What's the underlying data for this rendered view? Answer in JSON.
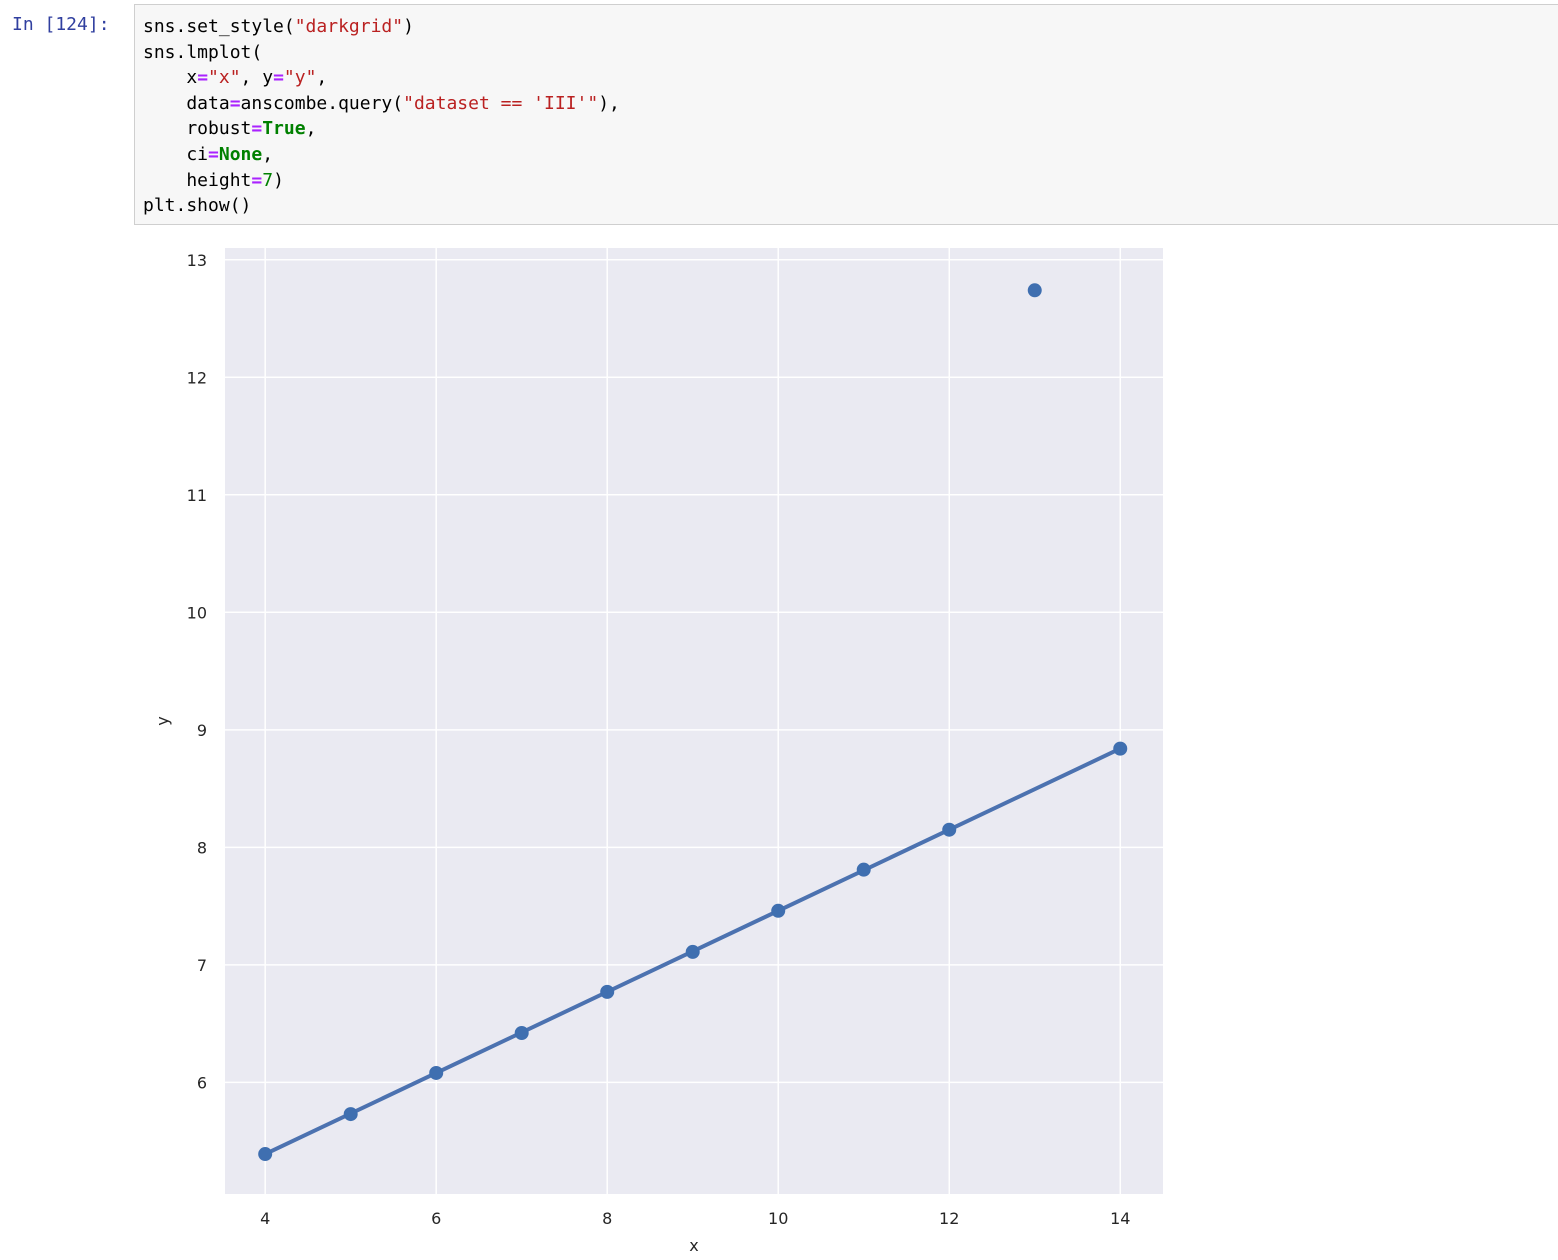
{
  "cell": {
    "prompt": "In [124]:",
    "code_lines": [
      [
        {
          "t": "sns.set_style(",
          "c": ""
        },
        {
          "t": "\"darkgrid\"",
          "c": "str"
        },
        {
          "t": ")",
          "c": ""
        }
      ],
      [
        {
          "t": "sns.lmplot(",
          "c": ""
        }
      ],
      [
        {
          "t": "    x",
          "c": ""
        },
        {
          "t": "=",
          "c": "op"
        },
        {
          "t": "\"x\"",
          "c": "str"
        },
        {
          "t": ", y",
          "c": ""
        },
        {
          "t": "=",
          "c": "op"
        },
        {
          "t": "\"y\"",
          "c": "str"
        },
        {
          "t": ",",
          "c": ""
        }
      ],
      [
        {
          "t": "    data",
          "c": ""
        },
        {
          "t": "=",
          "c": "op"
        },
        {
          "t": "anscombe.query(",
          "c": ""
        },
        {
          "t": "\"dataset == 'III'\"",
          "c": "str"
        },
        {
          "t": "),",
          "c": ""
        }
      ],
      [
        {
          "t": "    robust",
          "c": ""
        },
        {
          "t": "=",
          "c": "op"
        },
        {
          "t": "True",
          "c": "kw"
        },
        {
          "t": ",",
          "c": ""
        }
      ],
      [
        {
          "t": "    ci",
          "c": ""
        },
        {
          "t": "=",
          "c": "op"
        },
        {
          "t": "None",
          "c": "kw"
        },
        {
          "t": ",",
          "c": ""
        }
      ],
      [
        {
          "t": "    height",
          "c": ""
        },
        {
          "t": "=",
          "c": "op"
        },
        {
          "t": "7",
          "c": "num"
        },
        {
          "t": ")",
          "c": ""
        }
      ],
      [
        {
          "t": "plt.show()",
          "c": ""
        }
      ]
    ]
  },
  "colors": {
    "plot_background": "#eaeaf2",
    "grid": "#ffffff",
    "series": "#4c72b0",
    "point": "#3f6fb0"
  },
  "chart_data": {
    "type": "scatter",
    "xlabel": "x",
    "ylabel": "y",
    "xlim": [
      3.53,
      14.5
    ],
    "ylim": [
      5.05,
      13.1
    ],
    "xticks": [
      4,
      6,
      8,
      10,
      12,
      14
    ],
    "yticks": [
      6,
      7,
      8,
      9,
      10,
      11,
      12,
      13
    ],
    "grid": true,
    "points": [
      {
        "x": 4,
        "y": 5.39
      },
      {
        "x": 5,
        "y": 5.73
      },
      {
        "x": 6,
        "y": 6.08
      },
      {
        "x": 7,
        "y": 6.42
      },
      {
        "x": 8,
        "y": 6.77
      },
      {
        "x": 9,
        "y": 7.11
      },
      {
        "x": 10,
        "y": 7.46
      },
      {
        "x": 11,
        "y": 7.81
      },
      {
        "x": 12,
        "y": 8.15
      },
      {
        "x": 13,
        "y": 12.74
      },
      {
        "x": 14,
        "y": 8.84
      }
    ],
    "regression_line": {
      "x": [
        4,
        14
      ],
      "y": [
        5.39,
        8.84
      ]
    }
  }
}
